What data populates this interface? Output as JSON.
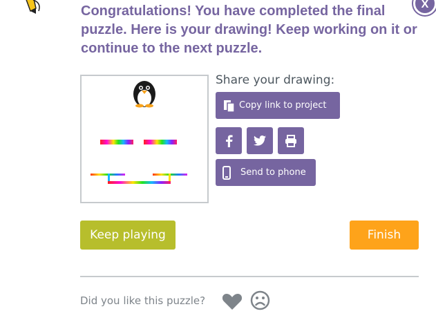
{
  "dialog": {
    "heading": "Congratulations! You have completed the final puzzle. Here is your drawing! Keep working on it or continue to the next puzzle.",
    "close_label": "X"
  },
  "share": {
    "label": "Share your drawing:",
    "copy_link_label": "Copy link to project",
    "send_to_phone_label": "Send to phone",
    "social_icons": [
      "facebook-icon",
      "twitter-icon",
      "print-icon"
    ]
  },
  "actions": {
    "keep_playing_label": "Keep playing",
    "finish_label": "Finish"
  },
  "feedback": {
    "label": "Did you like this puzzle?",
    "icons": [
      "heart-icon",
      "frown-icon"
    ]
  },
  "colors": {
    "brand_purple": "#7665a0",
    "keep_playing_green": "#b7be2c",
    "finish_orange": "#fea31a",
    "border_gray": "#c6cacd",
    "feedback_icon_gray": "#7e848a"
  }
}
